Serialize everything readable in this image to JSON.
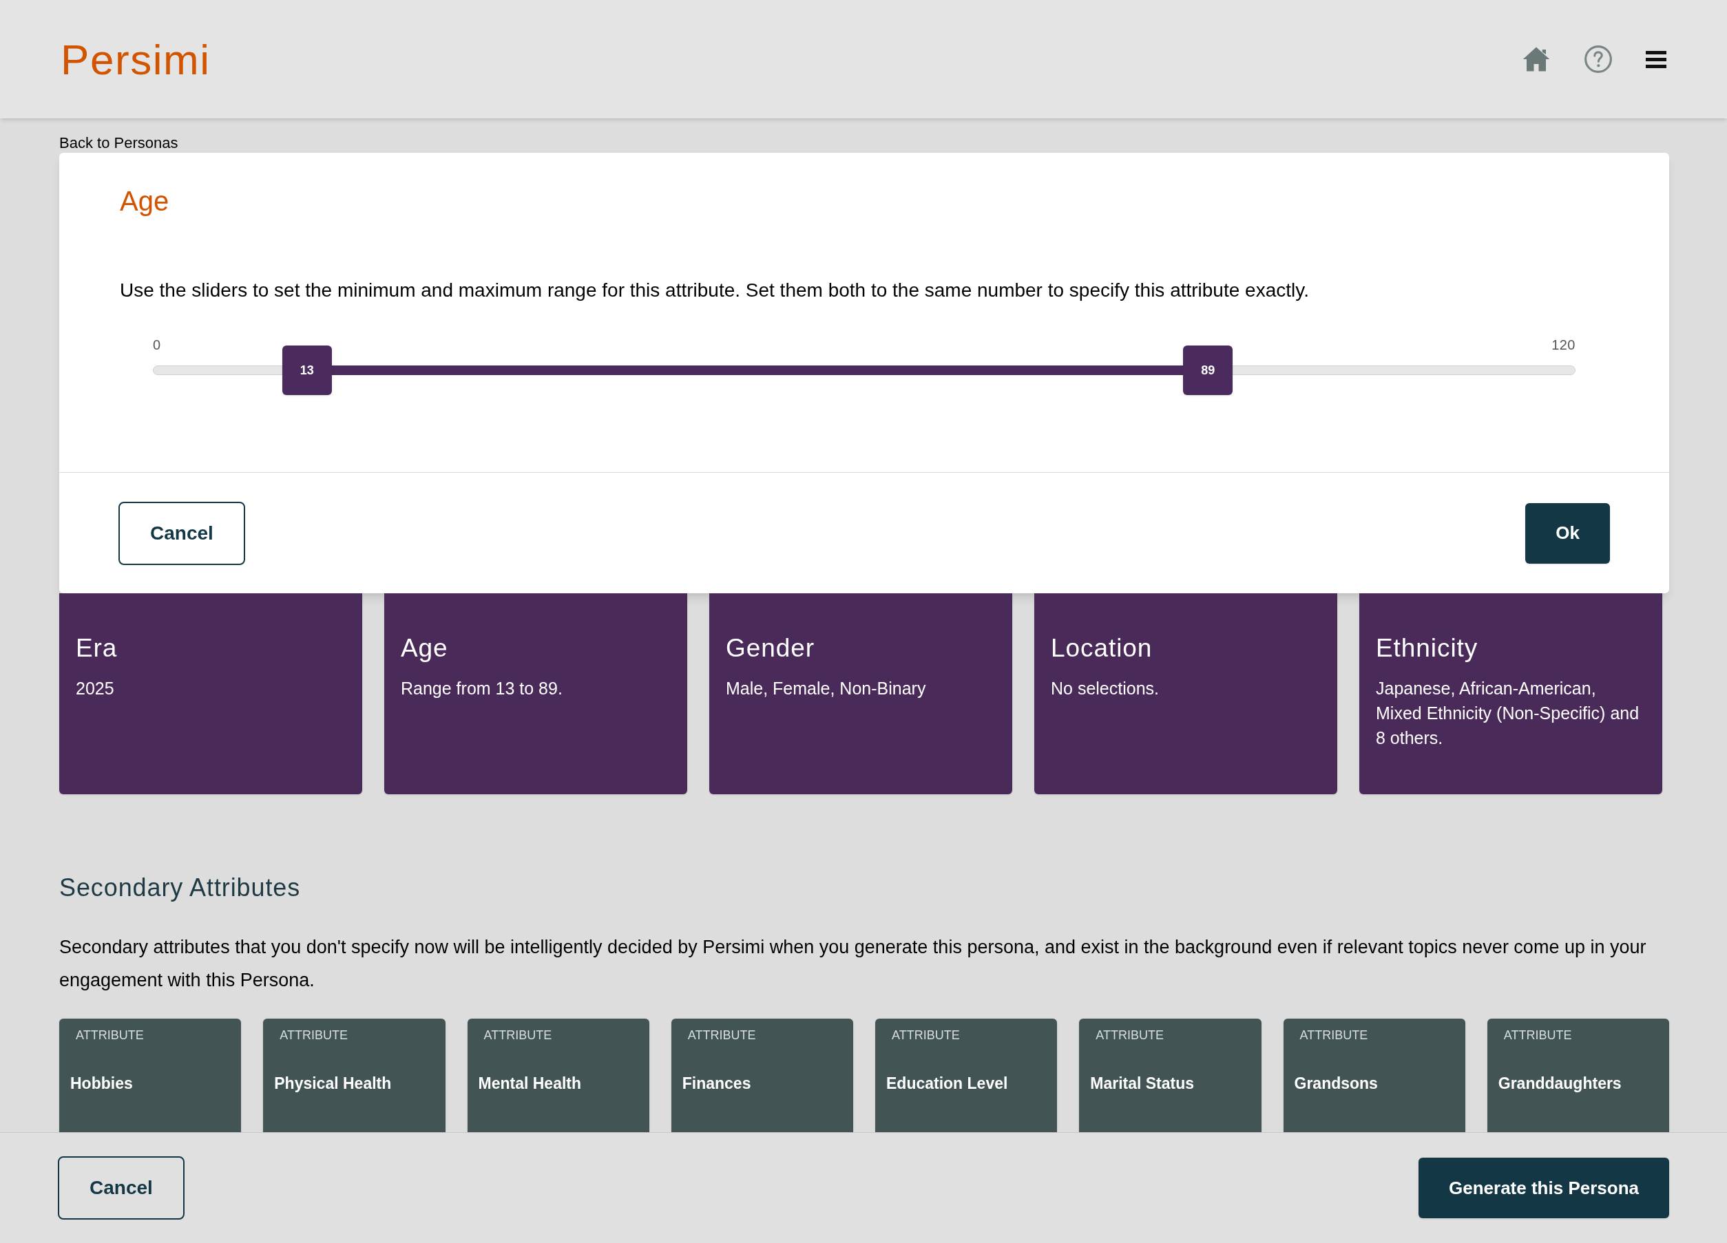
{
  "header": {
    "logo": "Persimi"
  },
  "back_link": "Back to Personas",
  "modal": {
    "title": "Age",
    "description": "Use the sliders to set the minimum and maximum range for this attribute. Set them both to the same number to specify this attribute exactly.",
    "slider": {
      "min_label": "0",
      "max_label": "120",
      "handles": [
        {
          "value": "13",
          "level": 0.1083
        },
        {
          "value": "89",
          "level": 0.7417
        }
      ]
    },
    "buttons": [
      {
        "label": "Cancel",
        "kind": "secondary"
      },
      {
        "label": "Ok",
        "kind": "primary"
      }
    ]
  },
  "primary_attributes": [
    {
      "title": "Era",
      "value": "2025"
    },
    {
      "title": "Age",
      "value": "Range from 13 to 89."
    },
    {
      "title": "Gender",
      "value": "Male, Female, Non-Binary"
    },
    {
      "title": "Location",
      "value": "No selections."
    },
    {
      "title": "Ethnicity",
      "value": "Japanese, African-American, Mixed Ethnicity (Non-Specific) and 8 others."
    }
  ],
  "secondary": {
    "title": "Secondary Attributes",
    "description": "Secondary attributes that you don't specify now will be intelligently decided by Persimi when you generate this persona, and exist in the background even if relevant topics never come up in your engagement with this Persona.",
    "attributes": [
      {
        "caption": "ATTRIBUTE",
        "name": "Hobbies"
      },
      {
        "caption": "ATTRIBUTE",
        "name": "Physical Health"
      },
      {
        "caption": "ATTRIBUTE",
        "name": "Mental Health"
      },
      {
        "caption": "ATTRIBUTE",
        "name": "Finances"
      },
      {
        "caption": "ATTRIBUTE",
        "name": "Education Level"
      },
      {
        "caption": "ATTRIBUTE",
        "name": "Marital Status"
      },
      {
        "caption": "ATTRIBUTE",
        "name": "Grandsons"
      },
      {
        "caption": "ATTRIBUTE",
        "name": "Granddaughters"
      }
    ]
  },
  "footer": {
    "buttons": [
      {
        "label": "Cancel",
        "kind": "secondary"
      },
      {
        "label": "Generate this Persona",
        "kind": "primary"
      }
    ]
  }
}
